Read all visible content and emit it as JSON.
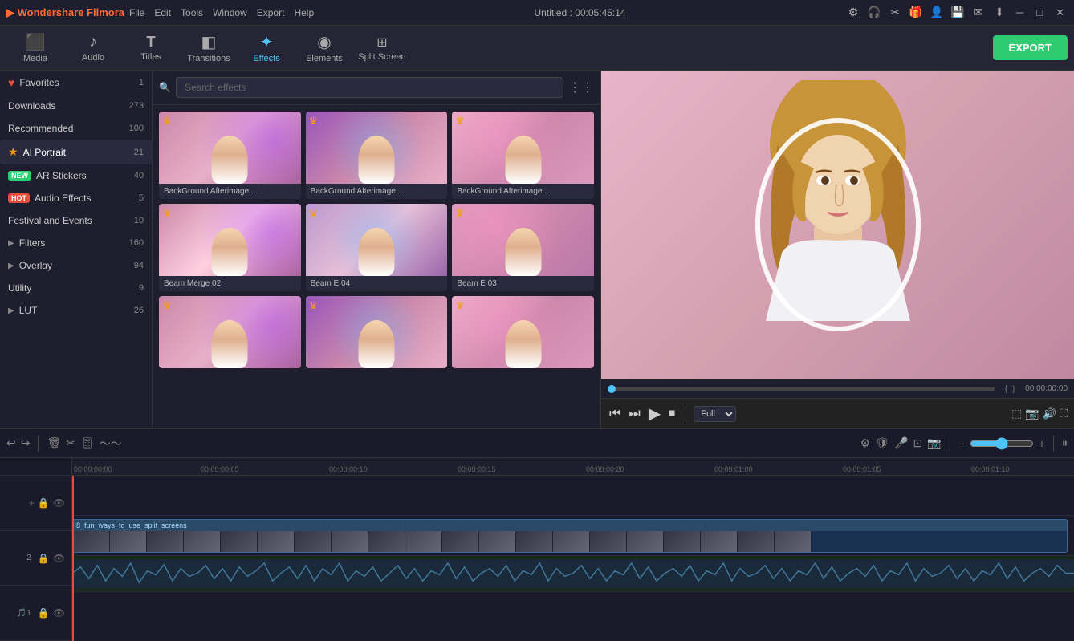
{
  "app": {
    "name": "Wondershare Filmora",
    "title": "Untitled : 00:05:45:14"
  },
  "titlebar": {
    "menus": [
      "File",
      "Edit",
      "Tools",
      "Window",
      "Export",
      "Help"
    ],
    "window_controls": [
      "minimize",
      "maximize",
      "close"
    ]
  },
  "toolbar": {
    "items": [
      {
        "id": "media",
        "label": "Media",
        "icon": "⬛"
      },
      {
        "id": "audio",
        "label": "Audio",
        "icon": "🎵"
      },
      {
        "id": "titles",
        "label": "Titles",
        "icon": "T"
      },
      {
        "id": "transitions",
        "label": "Transitions",
        "icon": "◧"
      },
      {
        "id": "effects",
        "label": "Effects",
        "icon": "✦"
      },
      {
        "id": "elements",
        "label": "Elements",
        "icon": "◉"
      },
      {
        "id": "split_screen",
        "label": "Split Screen",
        "icon": "⊞"
      }
    ],
    "active": "effects",
    "export_label": "EXPORT"
  },
  "sidebar": {
    "items": [
      {
        "id": "favorites",
        "label": "Favorites",
        "count": 1,
        "icon": "heart"
      },
      {
        "id": "downloads",
        "label": "Downloads",
        "count": 273
      },
      {
        "id": "recommended",
        "label": "Recommended",
        "count": 100
      },
      {
        "id": "ai_portrait",
        "label": "AI Portrait",
        "count": 21,
        "active": true,
        "icon": "star"
      },
      {
        "id": "ar_stickers",
        "label": "AR Stickers",
        "count": 40,
        "badge": "NEW"
      },
      {
        "id": "audio_effects",
        "label": "Audio Effects",
        "count": 5,
        "badge": "HOT"
      },
      {
        "id": "festival_events",
        "label": "Festival and Events",
        "count": 10
      },
      {
        "id": "filters",
        "label": "Filters",
        "count": 160,
        "arrow": true
      },
      {
        "id": "overlay",
        "label": "Overlay",
        "count": 94,
        "arrow": true
      },
      {
        "id": "utility",
        "label": "Utility",
        "count": 9
      },
      {
        "id": "lut",
        "label": "LUT",
        "count": 26,
        "arrow": true
      }
    ]
  },
  "effects": {
    "search_placeholder": "Search effects",
    "items": [
      {
        "id": 1,
        "name": "BackGround Afterimage ...",
        "thumb_class": "thumb-1",
        "crown": true
      },
      {
        "id": 2,
        "name": "BackGround Afterimage ...",
        "thumb_class": "thumb-2",
        "crown": true
      },
      {
        "id": 3,
        "name": "BackGround Afterimage ...",
        "thumb_class": "thumb-3",
        "crown": true
      },
      {
        "id": 4,
        "name": "Beam Merge 02",
        "thumb_class": "thumb-4",
        "crown": true
      },
      {
        "id": 5,
        "name": "Beam E 04",
        "thumb_class": "thumb-5",
        "crown": true
      },
      {
        "id": 6,
        "name": "Beam E 03",
        "thumb_class": "thumb-6",
        "crown": true
      },
      {
        "id": 7,
        "name": "",
        "thumb_class": "thumb-1",
        "crown": true
      },
      {
        "id": 8,
        "name": "",
        "thumb_class": "thumb-2",
        "crown": true
      },
      {
        "id": 9,
        "name": "",
        "thumb_class": "thumb-3",
        "crown": true
      }
    ]
  },
  "preview": {
    "time_current": "00:00:00:00",
    "time_start": "",
    "time_end": "",
    "zoom": "Full",
    "progress": 0
  },
  "timeline": {
    "time_markers": [
      "00:00:00:00",
      "00:00:00:05",
      "00:00:00:10",
      "00:00:00:15",
      "00:00:00:20",
      "00:00:01:00",
      "00:00:01:05",
      "00:00:01:10"
    ],
    "tracks": [
      {
        "type": "empty",
        "label": ""
      },
      {
        "type": "video",
        "label": "8_fun_ways_to_use_split_screens"
      },
      {
        "type": "audio",
        "label": ""
      }
    ]
  }
}
